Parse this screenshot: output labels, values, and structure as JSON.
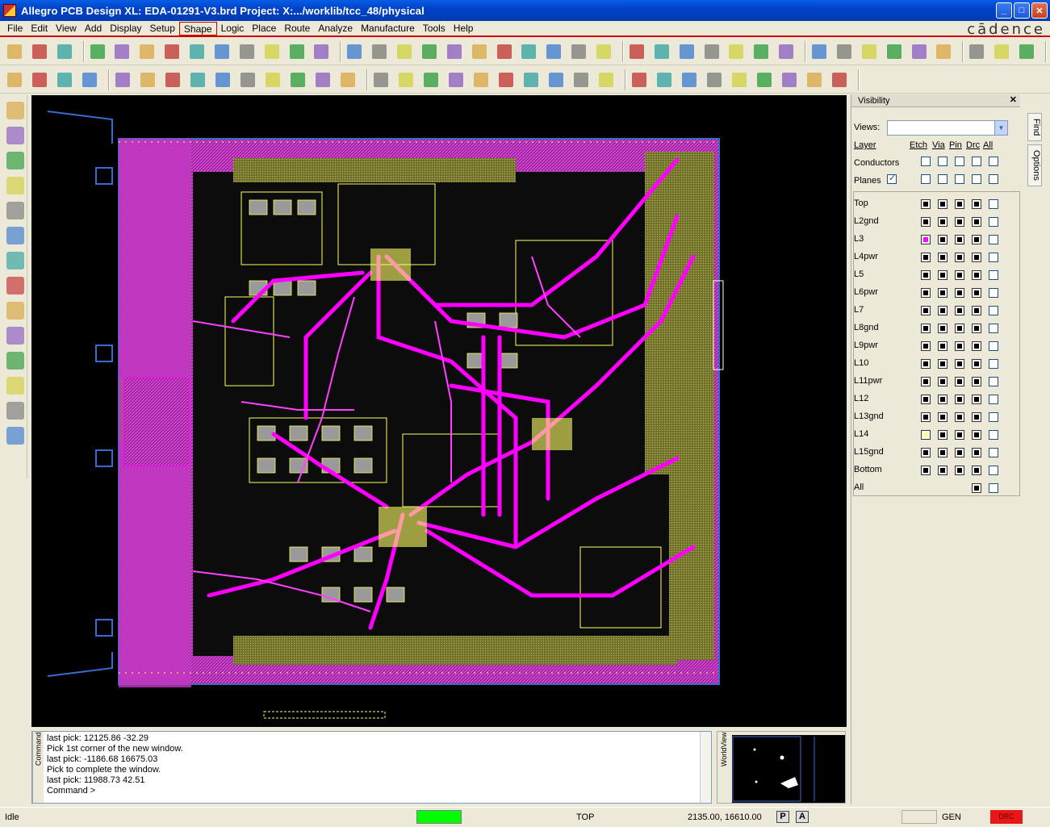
{
  "window": {
    "title": "Allegro PCB Design XL: EDA-01291-V3.brd  Project: X:.../worklib/tcc_48/physical"
  },
  "menu": {
    "items": [
      "File",
      "Edit",
      "View",
      "Add",
      "Display",
      "Setup",
      "Shape",
      "Logic",
      "Place",
      "Route",
      "Analyze",
      "Manufacture",
      "Tools",
      "Help"
    ],
    "active": "Shape",
    "brand": "cādence"
  },
  "console": {
    "tab_label": "Command",
    "lines": [
      "last pick:  12125.86  -32.29",
      "Pick 1st corner of the new window.",
      "last pick:  -1186.68  16675.03",
      "Pick to complete the window.",
      "last pick:  11988.73  42.51",
      "Command >"
    ]
  },
  "worldview": {
    "tab_label": "WorldView"
  },
  "visibility": {
    "title": "Visibility",
    "views_label": "Views:",
    "views_value": "",
    "headers": {
      "layer": "Layer",
      "etch": "Etch",
      "via": "Via",
      "pin": "Pin",
      "drc": "Drc",
      "all": "All"
    },
    "conductors_label": "Conductors",
    "planes_label": "Planes",
    "planes_checked": true,
    "layers": [
      {
        "name": "Top",
        "color": "black"
      },
      {
        "name": "L2gnd",
        "color": "black"
      },
      {
        "name": "L3",
        "color": "magenta"
      },
      {
        "name": "L4pwr",
        "color": "black"
      },
      {
        "name": "L5",
        "color": "black"
      },
      {
        "name": "L6pwr",
        "color": "black"
      },
      {
        "name": "L7",
        "color": "black"
      },
      {
        "name": "L8gnd",
        "color": "black"
      },
      {
        "name": "L9pwr",
        "color": "black"
      },
      {
        "name": "L10",
        "color": "black"
      },
      {
        "name": "L11pwr",
        "color": "black"
      },
      {
        "name": "L12",
        "color": "black"
      },
      {
        "name": "L13gnd",
        "color": "black"
      },
      {
        "name": "L14",
        "color": "yellow"
      },
      {
        "name": "L15gnd",
        "color": "black"
      },
      {
        "name": "Bottom",
        "color": "black"
      }
    ],
    "all_label": "All"
  },
  "side_tabs": [
    "Find",
    "Options"
  ],
  "status": {
    "mode": "Idle",
    "active_layer": "TOP",
    "coords": "2135.00, 16610.00",
    "p_button": "P",
    "a_button": "A",
    "gen": "GEN",
    "drc": "DRC"
  },
  "colors": {
    "title_bar": "#0054e3",
    "etch_magenta": "#ff00ff",
    "plane_olive": "#8a8a3a",
    "outline_blue": "#3a6ad0",
    "trace_yellow": "#ffff66"
  }
}
